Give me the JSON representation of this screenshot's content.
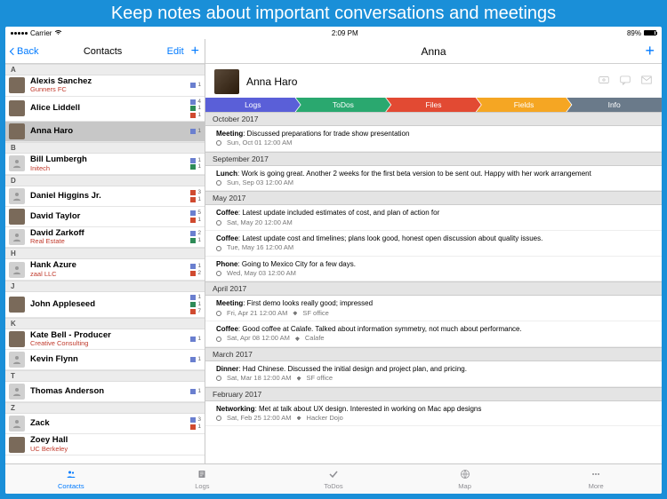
{
  "banner": "Keep notes about important conversations and meetings",
  "statusbar": {
    "carrier": "Carrier",
    "time": "2:09 PM",
    "battery": "89%"
  },
  "leftNav": {
    "back": "Back",
    "title": "Contacts",
    "edit": "Edit"
  },
  "sections": [
    {
      "letter": "A",
      "rows": [
        {
          "name": "Alexis Sanchez",
          "company": "Gunners FC",
          "pic": true,
          "badges": [
            [
              "card",
              1
            ]
          ]
        },
        {
          "name": "Alice Liddell",
          "pic": true,
          "badges": [
            [
              "card",
              4
            ],
            [
              "check",
              1
            ],
            [
              "link",
              1
            ]
          ]
        },
        {
          "name": "Anna Haro",
          "selected": true,
          "pic": true,
          "badges": [
            [
              "card",
              1
            ]
          ]
        }
      ]
    },
    {
      "letter": "B",
      "rows": [
        {
          "name": "Bill Lumbergh",
          "company": "Initech",
          "badges": [
            [
              "card",
              1
            ],
            [
              "check",
              1
            ]
          ]
        }
      ]
    },
    {
      "letter": "D",
      "rows": [
        {
          "name": "Daniel Higgins Jr.",
          "badges": [
            [
              "link",
              3
            ],
            [
              "link",
              1
            ]
          ]
        },
        {
          "name": "David Taylor",
          "pic": true,
          "badges": [
            [
              "card",
              5
            ],
            [
              "link",
              1
            ]
          ]
        },
        {
          "name": "David Zarkoff",
          "company": "Real Estate",
          "badges": [
            [
              "card",
              2
            ],
            [
              "check",
              1
            ]
          ]
        }
      ]
    },
    {
      "letter": "H",
      "rows": [
        {
          "name": "Hank Azure",
          "company": "zaal LLC",
          "badges": [
            [
              "card",
              1
            ],
            [
              "link",
              2
            ]
          ]
        }
      ]
    },
    {
      "letter": "J",
      "rows": [
        {
          "name": "John Appleseed",
          "pic": true,
          "badges": [
            [
              "card",
              1
            ],
            [
              "check",
              1
            ],
            [
              "link",
              7
            ]
          ]
        }
      ]
    },
    {
      "letter": "K",
      "rows": [
        {
          "name": "Kate Bell - Producer",
          "company": "Creative Consulting",
          "pic": true,
          "badges": [
            [
              "card",
              1
            ]
          ]
        },
        {
          "name": "Kevin Flynn",
          "badges": [
            [
              "card",
              1
            ]
          ]
        }
      ]
    },
    {
      "letter": "T",
      "rows": [
        {
          "name": "Thomas Anderson",
          "badges": [
            [
              "card",
              1
            ]
          ]
        }
      ]
    },
    {
      "letter": "Z",
      "rows": [
        {
          "name": "Zack",
          "badges": [
            [
              "card",
              3
            ],
            [
              "link",
              1
            ]
          ]
        },
        {
          "name": "Zoey Hall",
          "company": "UC Berkeley",
          "pic": true
        }
      ]
    }
  ],
  "detail": {
    "title": "Anna",
    "name": "Anna Haro",
    "tabs": [
      {
        "label": "Logs",
        "color": "#5a5fd8"
      },
      {
        "label": "ToDos",
        "color": "#2aa86f"
      },
      {
        "label": "Files",
        "color": "#e24a33"
      },
      {
        "label": "Fields",
        "color": "#f5a623"
      },
      {
        "label": "Info",
        "color": "#6a7a8a"
      }
    ],
    "months": [
      {
        "label": "October 2017",
        "entries": [
          {
            "kind": "Meeting",
            "text": "Discussed preparations for trade show presentation",
            "time": "Sun, Oct 01 12:00 AM"
          }
        ]
      },
      {
        "label": "September 2017",
        "entries": [
          {
            "kind": "Lunch",
            "text": "Work is going great. Another 2 weeks for the first beta version to be sent out. Happy with her work arrangement",
            "time": "Sun, Sep 03 12:00 AM"
          }
        ]
      },
      {
        "label": "May 2017",
        "entries": [
          {
            "kind": "Coffee",
            "text": "Latest update included estimates of cost, and plan of action for",
            "time": "Sat, May 20 12:00 AM"
          },
          {
            "kind": "Coffee",
            "text": "Latest update cost and timelines; plans look good, honest open discussion about quality issues.",
            "time": "Tue, May 16 12:00 AM"
          },
          {
            "kind": "Phone",
            "text": "Going to Mexico City for a few days.",
            "time": "Wed, May 03 12:00 AM"
          }
        ]
      },
      {
        "label": "April 2017",
        "entries": [
          {
            "kind": "Meeting",
            "text": "First demo looks really good; impressed",
            "time": "Fri, Apr 21 12:00 AM",
            "place": "SF office"
          },
          {
            "kind": "Coffee",
            "text": "Good coffee at Calafe. Talked about information symmetry, not much about performance.",
            "time": "Sat, Apr 08 12:00 AM",
            "place": "Calafe"
          }
        ]
      },
      {
        "label": "March 2017",
        "entries": [
          {
            "kind": "Dinner",
            "text": "Had Chinese. Discussed the initial design and project plan, and pricing.",
            "time": "Sat, Mar 18 12:00 AM",
            "place": "SF office"
          }
        ]
      },
      {
        "label": "February 2017",
        "entries": [
          {
            "kind": "Networking",
            "text": "Met at talk about UX design. Interested in working on Mac app designs",
            "time": "Sat, Feb 25 12:00 AM",
            "place": "Hacker Dojo"
          }
        ]
      }
    ]
  },
  "tabbar": [
    {
      "label": "Contacts",
      "active": true
    },
    {
      "label": "Logs"
    },
    {
      "label": "ToDos"
    },
    {
      "label": "Map"
    },
    {
      "label": "More"
    }
  ]
}
